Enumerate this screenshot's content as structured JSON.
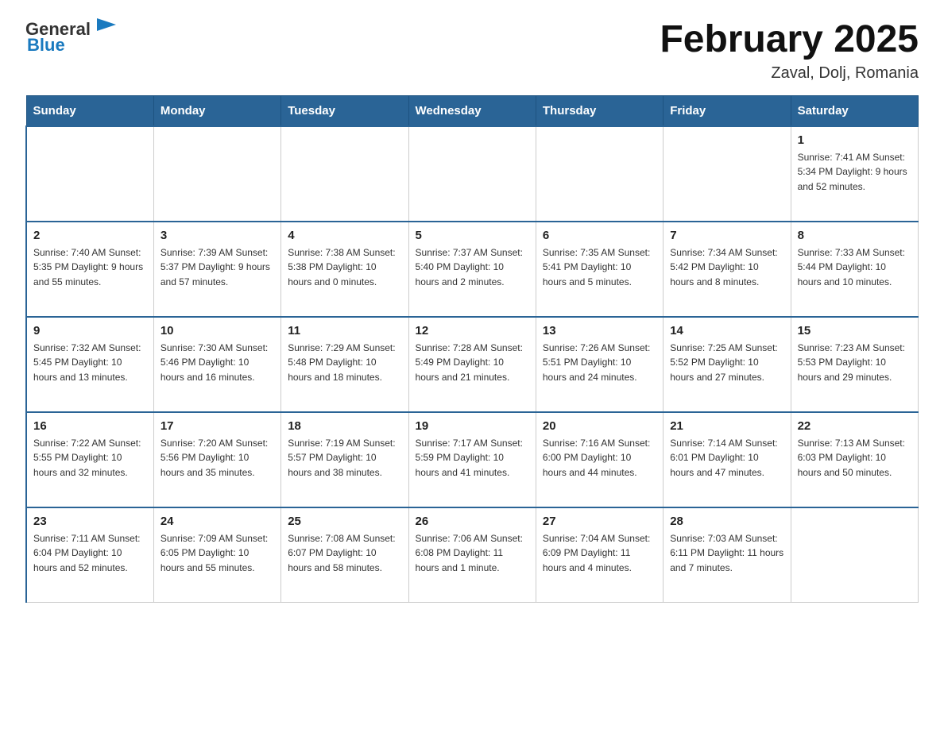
{
  "header": {
    "logo_general": "General",
    "logo_blue": "Blue",
    "title": "February 2025",
    "location": "Zaval, Dolj, Romania"
  },
  "weekdays": [
    "Sunday",
    "Monday",
    "Tuesday",
    "Wednesday",
    "Thursday",
    "Friday",
    "Saturday"
  ],
  "weeks": [
    [
      {
        "day": "",
        "info": ""
      },
      {
        "day": "",
        "info": ""
      },
      {
        "day": "",
        "info": ""
      },
      {
        "day": "",
        "info": ""
      },
      {
        "day": "",
        "info": ""
      },
      {
        "day": "",
        "info": ""
      },
      {
        "day": "1",
        "info": "Sunrise: 7:41 AM\nSunset: 5:34 PM\nDaylight: 9 hours\nand 52 minutes."
      }
    ],
    [
      {
        "day": "2",
        "info": "Sunrise: 7:40 AM\nSunset: 5:35 PM\nDaylight: 9 hours\nand 55 minutes."
      },
      {
        "day": "3",
        "info": "Sunrise: 7:39 AM\nSunset: 5:37 PM\nDaylight: 9 hours\nand 57 minutes."
      },
      {
        "day": "4",
        "info": "Sunrise: 7:38 AM\nSunset: 5:38 PM\nDaylight: 10 hours\nand 0 minutes."
      },
      {
        "day": "5",
        "info": "Sunrise: 7:37 AM\nSunset: 5:40 PM\nDaylight: 10 hours\nand 2 minutes."
      },
      {
        "day": "6",
        "info": "Sunrise: 7:35 AM\nSunset: 5:41 PM\nDaylight: 10 hours\nand 5 minutes."
      },
      {
        "day": "7",
        "info": "Sunrise: 7:34 AM\nSunset: 5:42 PM\nDaylight: 10 hours\nand 8 minutes."
      },
      {
        "day": "8",
        "info": "Sunrise: 7:33 AM\nSunset: 5:44 PM\nDaylight: 10 hours\nand 10 minutes."
      }
    ],
    [
      {
        "day": "9",
        "info": "Sunrise: 7:32 AM\nSunset: 5:45 PM\nDaylight: 10 hours\nand 13 minutes."
      },
      {
        "day": "10",
        "info": "Sunrise: 7:30 AM\nSunset: 5:46 PM\nDaylight: 10 hours\nand 16 minutes."
      },
      {
        "day": "11",
        "info": "Sunrise: 7:29 AM\nSunset: 5:48 PM\nDaylight: 10 hours\nand 18 minutes."
      },
      {
        "day": "12",
        "info": "Sunrise: 7:28 AM\nSunset: 5:49 PM\nDaylight: 10 hours\nand 21 minutes."
      },
      {
        "day": "13",
        "info": "Sunrise: 7:26 AM\nSunset: 5:51 PM\nDaylight: 10 hours\nand 24 minutes."
      },
      {
        "day": "14",
        "info": "Sunrise: 7:25 AM\nSunset: 5:52 PM\nDaylight: 10 hours\nand 27 minutes."
      },
      {
        "day": "15",
        "info": "Sunrise: 7:23 AM\nSunset: 5:53 PM\nDaylight: 10 hours\nand 29 minutes."
      }
    ],
    [
      {
        "day": "16",
        "info": "Sunrise: 7:22 AM\nSunset: 5:55 PM\nDaylight: 10 hours\nand 32 minutes."
      },
      {
        "day": "17",
        "info": "Sunrise: 7:20 AM\nSunset: 5:56 PM\nDaylight: 10 hours\nand 35 minutes."
      },
      {
        "day": "18",
        "info": "Sunrise: 7:19 AM\nSunset: 5:57 PM\nDaylight: 10 hours\nand 38 minutes."
      },
      {
        "day": "19",
        "info": "Sunrise: 7:17 AM\nSunset: 5:59 PM\nDaylight: 10 hours\nand 41 minutes."
      },
      {
        "day": "20",
        "info": "Sunrise: 7:16 AM\nSunset: 6:00 PM\nDaylight: 10 hours\nand 44 minutes."
      },
      {
        "day": "21",
        "info": "Sunrise: 7:14 AM\nSunset: 6:01 PM\nDaylight: 10 hours\nand 47 minutes."
      },
      {
        "day": "22",
        "info": "Sunrise: 7:13 AM\nSunset: 6:03 PM\nDaylight: 10 hours\nand 50 minutes."
      }
    ],
    [
      {
        "day": "23",
        "info": "Sunrise: 7:11 AM\nSunset: 6:04 PM\nDaylight: 10 hours\nand 52 minutes."
      },
      {
        "day": "24",
        "info": "Sunrise: 7:09 AM\nSunset: 6:05 PM\nDaylight: 10 hours\nand 55 minutes."
      },
      {
        "day": "25",
        "info": "Sunrise: 7:08 AM\nSunset: 6:07 PM\nDaylight: 10 hours\nand 58 minutes."
      },
      {
        "day": "26",
        "info": "Sunrise: 7:06 AM\nSunset: 6:08 PM\nDaylight: 11 hours\nand 1 minute."
      },
      {
        "day": "27",
        "info": "Sunrise: 7:04 AM\nSunset: 6:09 PM\nDaylight: 11 hours\nand 4 minutes."
      },
      {
        "day": "28",
        "info": "Sunrise: 7:03 AM\nSunset: 6:11 PM\nDaylight: 11 hours\nand 7 minutes."
      },
      {
        "day": "",
        "info": ""
      }
    ]
  ]
}
